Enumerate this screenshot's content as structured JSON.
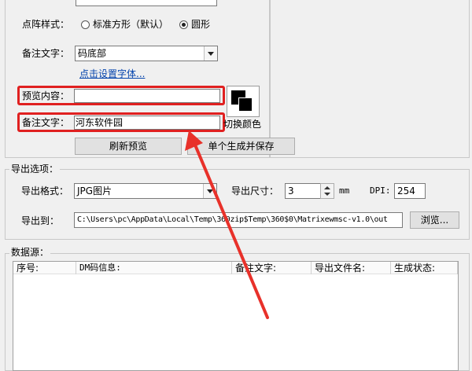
{
  "preview_settings": {
    "dot_style_label": "点阵样式：",
    "dot_style_options": [
      {
        "label": "标准方形（默认）",
        "selected": false
      },
      {
        "label": "圆形",
        "selected": true
      }
    ],
    "note_text_label": "备注文字：",
    "note_position_value": "码底部",
    "font_link": "点击设置字体...",
    "preview_content_label": "预览内容：",
    "preview_content_value": "",
    "note_text_label2": "备注文字：",
    "note_text_value": "河东软件园",
    "toggle_color_label": "切换颜色",
    "refresh_button": "刷新预览",
    "generate_button": "单个生成并保存"
  },
  "export_options": {
    "legend": "导出选项：",
    "format_label": "导出格式：",
    "format_value": "JPG图片",
    "size_label": "导出尺寸：",
    "size_value": "3",
    "size_unit": "mm",
    "dpi_label": "DPI:",
    "dpi_value": "254",
    "export_to_label": "导出到：",
    "export_path": "C:\\Users\\pc\\AppData\\Local\\Temp\\360zip$Temp\\360$0\\Matrixewmsc-v1.0\\out",
    "browse_button": "浏览..."
  },
  "data_source": {
    "legend": "数据源：",
    "columns": [
      "序号:",
      "DM码信息:",
      "备注文字:",
      "导出文件名:",
      "生成状态:"
    ]
  },
  "colors": {
    "highlight": "#e02020",
    "arrow": "#e8312a",
    "link": "#0645ad"
  }
}
